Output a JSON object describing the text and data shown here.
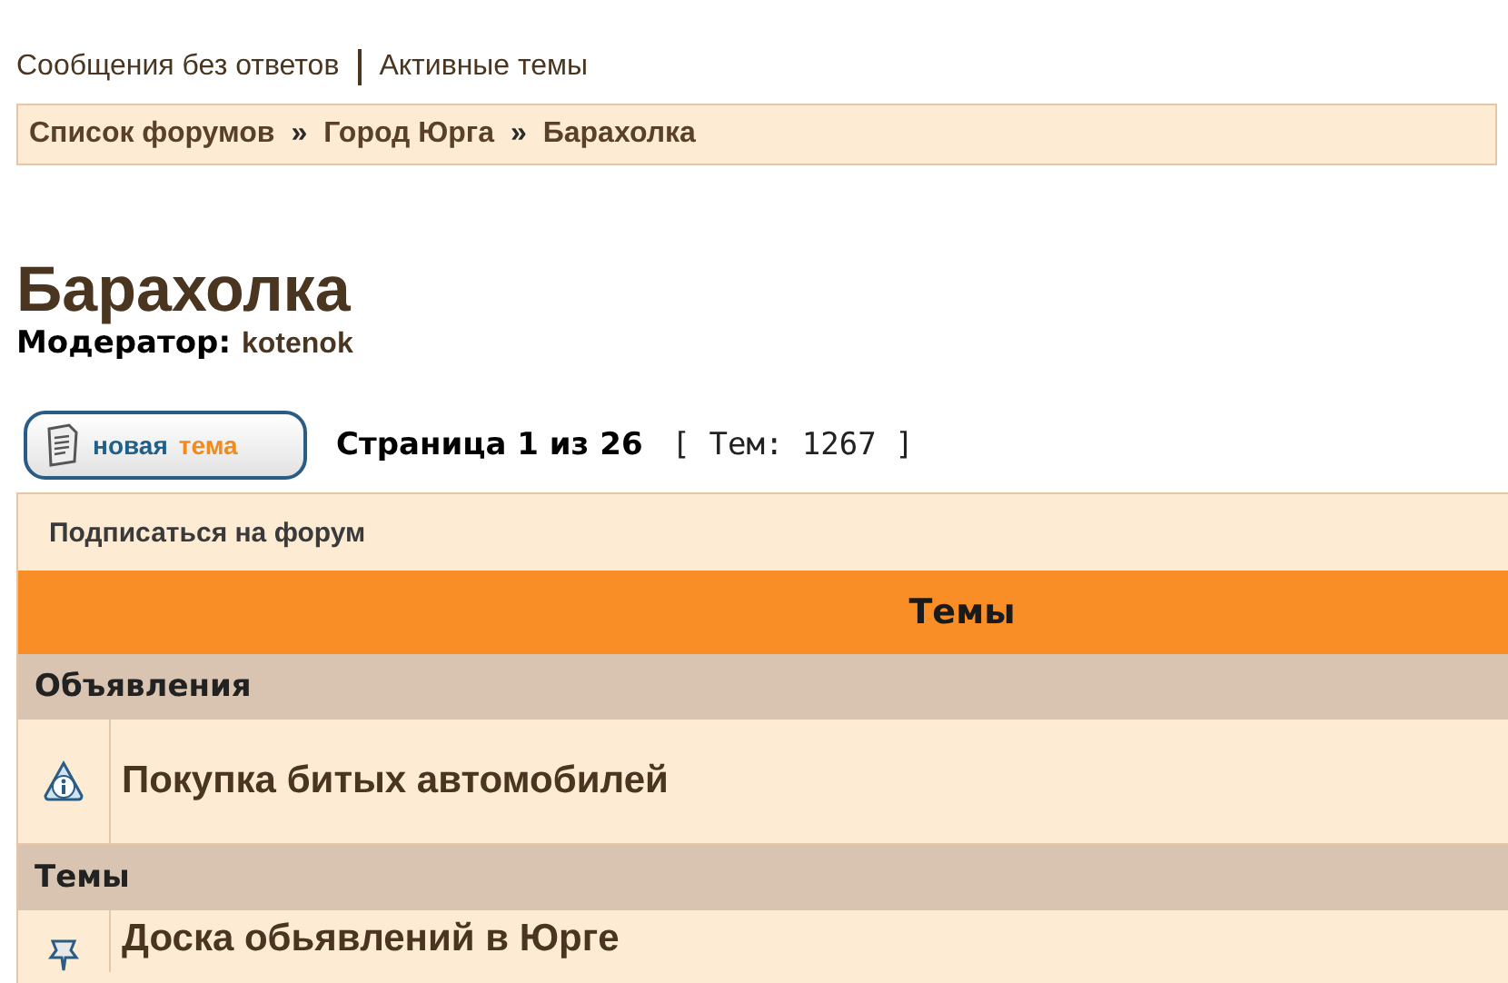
{
  "top_links": [
    "Сообщения без ответов",
    "Активные темы"
  ],
  "breadcrumbs": [
    "Список форумов",
    "Город Юрга",
    "Барахолка"
  ],
  "breadcrumb_separator": "»",
  "title": "Барахолка",
  "moderator": {
    "label": "Модератор:",
    "name": "kotenok"
  },
  "new_topic_button": {
    "words": [
      "новая",
      "тема"
    ]
  },
  "pagination": "Страница **1** из **26**",
  "topic_count": "[ Тем: 1267 ]",
  "subscribe_link": "Подписаться на форум",
  "table": {
    "header": "Темы",
    "sections": [
      {
        "title": "Объявления",
        "rows": [
          {
            "kind": "announcement",
            "title": "Покупка битых автомобилей"
          }
        ]
      },
      {
        "title": "Темы",
        "rows": [
          {
            "kind": "sticky",
            "title": "Доска обьявлений в Юрге"
          }
        ]
      }
    ]
  }
}
